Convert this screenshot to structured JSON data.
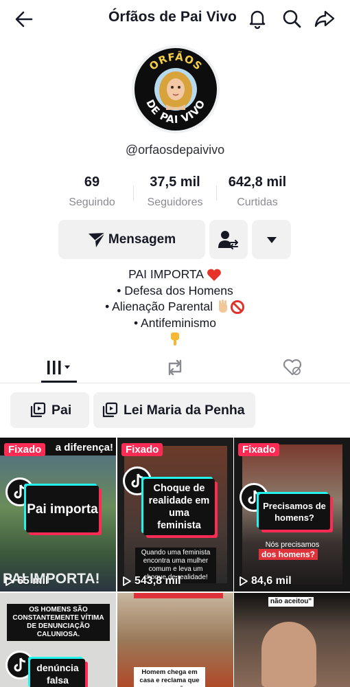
{
  "header": {
    "title": "Órfãos de Pai Vivo",
    "icons": [
      "back-arrow-icon",
      "bell-icon",
      "search-icon",
      "share-icon"
    ]
  },
  "profile": {
    "avatar_text_top": "ORFÃOS",
    "avatar_text_bottom": "DE PAI VIVO",
    "handle": "@orfaosdepaivivo",
    "stats": [
      {
        "value": "69",
        "label": "Seguindo"
      },
      {
        "value": "37,5 mil",
        "label": "Seguidores"
      },
      {
        "value": "642,8 mil",
        "label": "Curtidas"
      }
    ]
  },
  "actions": {
    "message_label": "Mensagem"
  },
  "bio": {
    "line1": "PAI IMPORTA",
    "line2": "• Defesa dos Homens",
    "line3": "• Alienação Parental",
    "line4": "• Antifeminismo"
  },
  "tabs": [
    "videos-grid-icon",
    "reposts-icon",
    "liked-hidden-icon"
  ],
  "playlists": [
    {
      "label": "Pai"
    },
    {
      "label": "Lei Maria da Penha"
    }
  ],
  "videos": [
    {
      "pinned": "Fixado",
      "views": "65 mil",
      "card": "Pai importa",
      "top_text": "a diferença!",
      "bottom_text": "PAI IMPORTA!"
    },
    {
      "pinned": "Fixado",
      "views": "543,8 mil",
      "card": "Choque de realidade em uma feminista",
      "caption": "Quando uma feminista encontra uma mulher comum e leva um choque de realidade!"
    },
    {
      "pinned": "Fixado",
      "views": "84,6 mil",
      "card": "Precisamos de homens?",
      "caption_white": "Nós precisamos",
      "caption_red": "dos homens?"
    },
    {
      "caption": "OS HOMENS SÃO CONSTANTEMENTE VÍTIMA DE DENUNCIAÇÃO CALUNIOSA.",
      "card": "denúncia falsa"
    },
    {
      "caption": "Homem chega em casa e reclama que esposa não"
    },
    {
      "caption": "não aceitou\""
    }
  ]
}
